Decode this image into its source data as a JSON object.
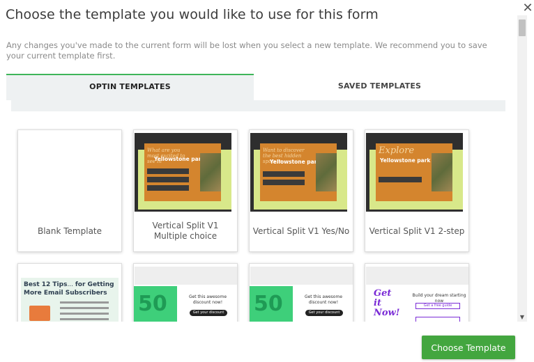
{
  "dialog": {
    "title": "Choose the template you would like to use for this form",
    "warning": "Any changes you've made to the current form will be lost when you select a new template. We recommend you to save your current template first."
  },
  "tabs": [
    {
      "label": "OPTIN TEMPLATES",
      "active": true
    },
    {
      "label": "SAVED TEMPLATES",
      "active": false
    }
  ],
  "templates": [
    {
      "label": "Blank Template"
    },
    {
      "label": "Vertical Split V1 Multiple choice",
      "thumb_heading": "What are you most excited to see in",
      "thumb_title": "Yellowstone park?"
    },
    {
      "label": "Vertical Split V1 Yes/No",
      "thumb_heading": "Want to discover the best hidden spots in",
      "thumb_title": "Yellowstone park?"
    },
    {
      "label": "Vertical Split V1 2-step",
      "thumb_heading": "Explore",
      "thumb_title": "Yellowstone park"
    }
  ],
  "row2": [
    {
      "thumb_title": "Best 12 Tips",
      "thumb_title_rest": "for Getting More Email Subscribers"
    },
    {
      "num": "50",
      "promo": "Get this awesome discount now!",
      "cta": "Get your discount"
    },
    {
      "num": "50",
      "promo": "Get this awesome discount now!",
      "cta": "Get your discount"
    },
    {
      "thumb_title": "Get it Now!",
      "promo": "Build your dream starting now",
      "cta": "Get a free guide"
    }
  ],
  "footer": {
    "choose_label": "Choose Template"
  },
  "icons": {
    "close": "close-icon"
  },
  "colors": {
    "accent": "#43a63f",
    "tab_active_border": "#3fb55a"
  }
}
